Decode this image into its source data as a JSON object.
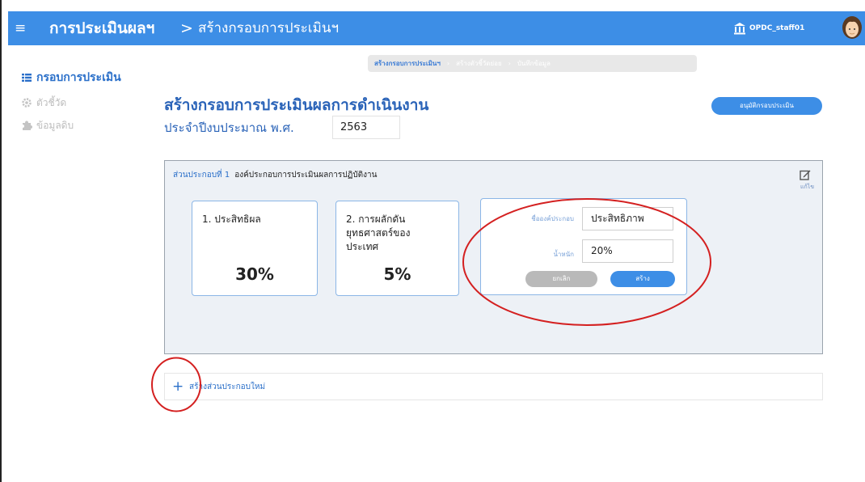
{
  "header": {
    "menu_icon": "hamburger-icon",
    "app_title": "การประเมินผลฯ",
    "breadcrumb_sep": ">",
    "breadcrumb_page": "สร้างกรอบการประเมินฯ",
    "user_icon": "building-icon",
    "user_name": "OPDC_staff01"
  },
  "sidebar": {
    "items": [
      {
        "label": "กรอบการประเมิน",
        "icon": "list-icon",
        "active": true
      },
      {
        "label": "ตัวชี้วัด",
        "icon": "gear-icon",
        "active": false
      },
      {
        "label": "ข้อมูลดิบ",
        "icon": "puzzle-icon",
        "active": false
      }
    ]
  },
  "stepper": {
    "steps": [
      "สร้างกรอบการประเมินฯ",
      "สร้างตัวชี้วัดย่อย",
      "บันทึกข้อมูล"
    ],
    "separator": "›",
    "active_index": 0
  },
  "main": {
    "title": "สร้างกรอบการประเมินผลการดำเนินงาน",
    "year_label": "ประจำปีงบประมาณ พ.ศ.",
    "year_value": "2563",
    "approve_button": "อนุมัติกรอบประเมิน"
  },
  "section": {
    "number_label": "ส่วนประกอบที่ 1",
    "title": "องค์ประกอบการประเมินผลการปฏิบัติงาน",
    "edit_label": "แก้ไข",
    "cards": [
      {
        "name": "1. ประสิทธิผล",
        "percent": "30%"
      },
      {
        "name": "2. การผลักดันยุทธศาสตร์ของประเทศ",
        "percent": "5%"
      }
    ],
    "form": {
      "name_label": "ชื่อองค์ประกอบ",
      "name_value": "ประสิทธิภาพ",
      "weight_label": "น้ำหนัก",
      "weight_value": "20%",
      "cancel_label": "ยกเลิก",
      "create_label": "สร้าง"
    }
  },
  "add_section": {
    "plus": "+",
    "label": "สร้างส่วนประกอบใหม่"
  },
  "colors": {
    "primary": "#3d8ee6",
    "title_text": "#2a63b8",
    "section_bg": "#edf1f6",
    "annotation": "#d42020"
  }
}
